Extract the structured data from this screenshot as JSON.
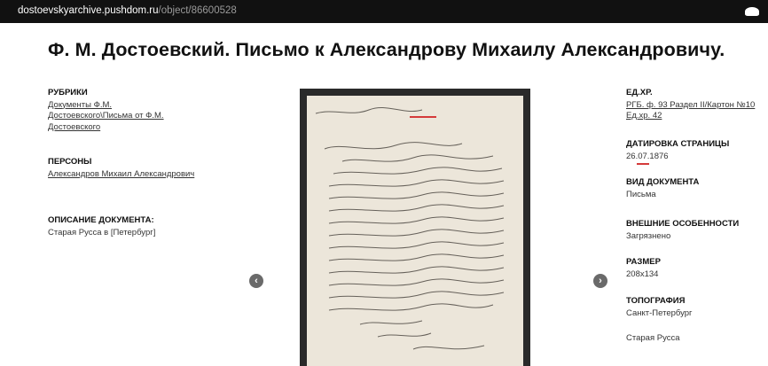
{
  "topbar": {
    "url_host": "dostoevskyarchive.pushdom.ru",
    "url_path": "/object/86600528"
  },
  "title": "Ф. М. Достоевский. Письмо к Александрову Михаилу Александровичу.",
  "left": {
    "rubriki": {
      "label": "РУБРИКИ",
      "lines": [
        "Документы Ф.М.",
        "Достоевского\\Письма от Ф.М.",
        "Достоевского"
      ]
    },
    "persons": {
      "label": "ПЕРСОНЫ",
      "value": "Александров Михаил Александрович"
    },
    "description": {
      "label": "ОПИСАНИЕ ДОКУМЕНТА:",
      "value": "Старая Русса в [Петербург]"
    }
  },
  "right": {
    "edhr": {
      "label": "ЕД.ХР.",
      "lines": [
        "РГБ. ф. 93 Раздел II/Картон №10",
        "Ед.хр. 42"
      ]
    },
    "date": {
      "label": "ДАТИРОВКА СТРАНИЦЫ",
      "value": "26.07.1876"
    },
    "doctype": {
      "label": "ВИД ДОКУМЕНТА",
      "value": "Письма"
    },
    "features": {
      "label": "ВНЕШНИЕ ОСОБЕННОСТИ",
      "value": "Загрязнено"
    },
    "size": {
      "label": "РАЗМЕР",
      "value": "208x134"
    },
    "topo": {
      "label": "ТОПОГРАФИЯ",
      "value": "Санкт-Петербург",
      "extra": "Старая Русса"
    }
  },
  "viewer": {
    "prev_icon": "chevron-left-icon",
    "next_icon": "chevron-right-icon",
    "prev_glyph": "‹",
    "next_glyph": "›"
  },
  "colors": {
    "topbar": "#111111",
    "highlight": "#d43a3a"
  }
}
